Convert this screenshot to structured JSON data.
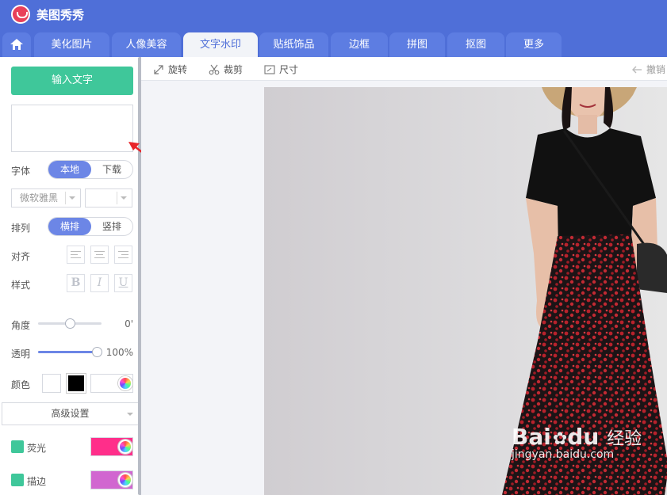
{
  "app": {
    "title": "美图秀秀"
  },
  "tabs": [
    {
      "label": "美化图片"
    },
    {
      "label": "人像美容"
    },
    {
      "label": "文字水印"
    },
    {
      "label": "贴纸饰品"
    },
    {
      "label": "边框"
    },
    {
      "label": "拼图"
    },
    {
      "label": "抠图"
    },
    {
      "label": "更多"
    }
  ],
  "toolbar": {
    "rotate": "旋转",
    "crop": "裁剪",
    "size": "尺寸",
    "undo": "撤销"
  },
  "panel": {
    "input_text_button": "输入文字",
    "text_value": "",
    "font_label": "字体",
    "font_local": "本地",
    "font_download": "下载",
    "font_family": "微软雅黑",
    "font_size": "",
    "arrange_label": "排列",
    "arrange_horizontal": "横排",
    "arrange_vertical": "竖排",
    "align_label": "对齐",
    "style_label": "样式",
    "bold": "B",
    "italic": "I",
    "underline": "U",
    "angle_label": "角度",
    "angle_value": "0'",
    "opacity_label": "透明",
    "opacity_value": "100%",
    "color_label": "颜色",
    "advanced_settings": "高级设置",
    "glow_label": "荧光",
    "stroke_label": "描边"
  },
  "colors": {
    "accent": "#4f6fd8",
    "green": "#3fc79a",
    "glow": "#ff2e8a",
    "stroke": "#d166d0",
    "text_color": "#000000"
  },
  "state": {
    "angle": 0,
    "opacity_percent": 100
  },
  "watermark": {
    "brand": "Bai",
    "brand2": "du",
    "cn": "经验",
    "url": "jingyan.baidu.com"
  }
}
